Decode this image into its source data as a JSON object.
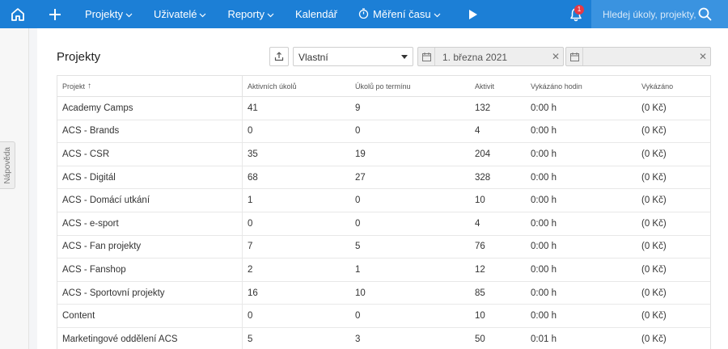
{
  "nav": {
    "items": [
      {
        "label": "Projekty",
        "dropdown": true,
        "icon": ""
      },
      {
        "label": "Uživatelé",
        "dropdown": true,
        "icon": ""
      },
      {
        "label": "Reporty",
        "dropdown": true,
        "icon": ""
      },
      {
        "label": "Kalendář",
        "dropdown": false,
        "icon": ""
      },
      {
        "label": "Měření času",
        "dropdown": true,
        "icon": "timer-icon"
      }
    ],
    "notification_count": "1",
    "search_placeholder": "Hledej úkoly, projekty, ...",
    "colors": {
      "bar": "#1c7fd6",
      "search": "#3a93e0",
      "badge": "#e63946"
    }
  },
  "help_tab": "Nápověda",
  "page": {
    "title": "Projekty",
    "period_select": "Vlastní",
    "date_from": "1. března 2021",
    "date_to": ""
  },
  "table": {
    "columns": [
      "Projekt",
      "Aktivních úkolů",
      "Úkolů po termínu",
      "Aktivit",
      "Vykázáno hodin",
      "Vykázáno"
    ],
    "sort_indicator": "↑",
    "rows": [
      [
        "Academy Camps",
        "41",
        "9",
        "132",
        "0:00 h",
        "(0 Kč)"
      ],
      [
        "ACS - Brands",
        "0",
        "0",
        "4",
        "0:00 h",
        "(0 Kč)"
      ],
      [
        "ACS - CSR",
        "35",
        "19",
        "204",
        "0:00 h",
        "(0 Kč)"
      ],
      [
        "ACS - Digitál",
        "68",
        "27",
        "328",
        "0:00 h",
        "(0 Kč)"
      ],
      [
        "ACS - Domácí utkání",
        "1",
        "0",
        "10",
        "0:00 h",
        "(0 Kč)"
      ],
      [
        "ACS - e-sport",
        "0",
        "0",
        "4",
        "0:00 h",
        "(0 Kč)"
      ],
      [
        "ACS - Fan projekty",
        "7",
        "5",
        "76",
        "0:00 h",
        "(0 Kč)"
      ],
      [
        "ACS - Fanshop",
        "2",
        "1",
        "12",
        "0:00 h",
        "(0 Kč)"
      ],
      [
        "ACS - Sportovní projekty",
        "16",
        "10",
        "85",
        "0:00 h",
        "(0 Kč)"
      ],
      [
        "Content",
        "0",
        "0",
        "10",
        "0:00 h",
        "(0 Kč)"
      ],
      [
        "Marketingové oddělení ACS",
        "5",
        "3",
        "50",
        "0:01 h",
        "(0 Kč)"
      ]
    ]
  }
}
